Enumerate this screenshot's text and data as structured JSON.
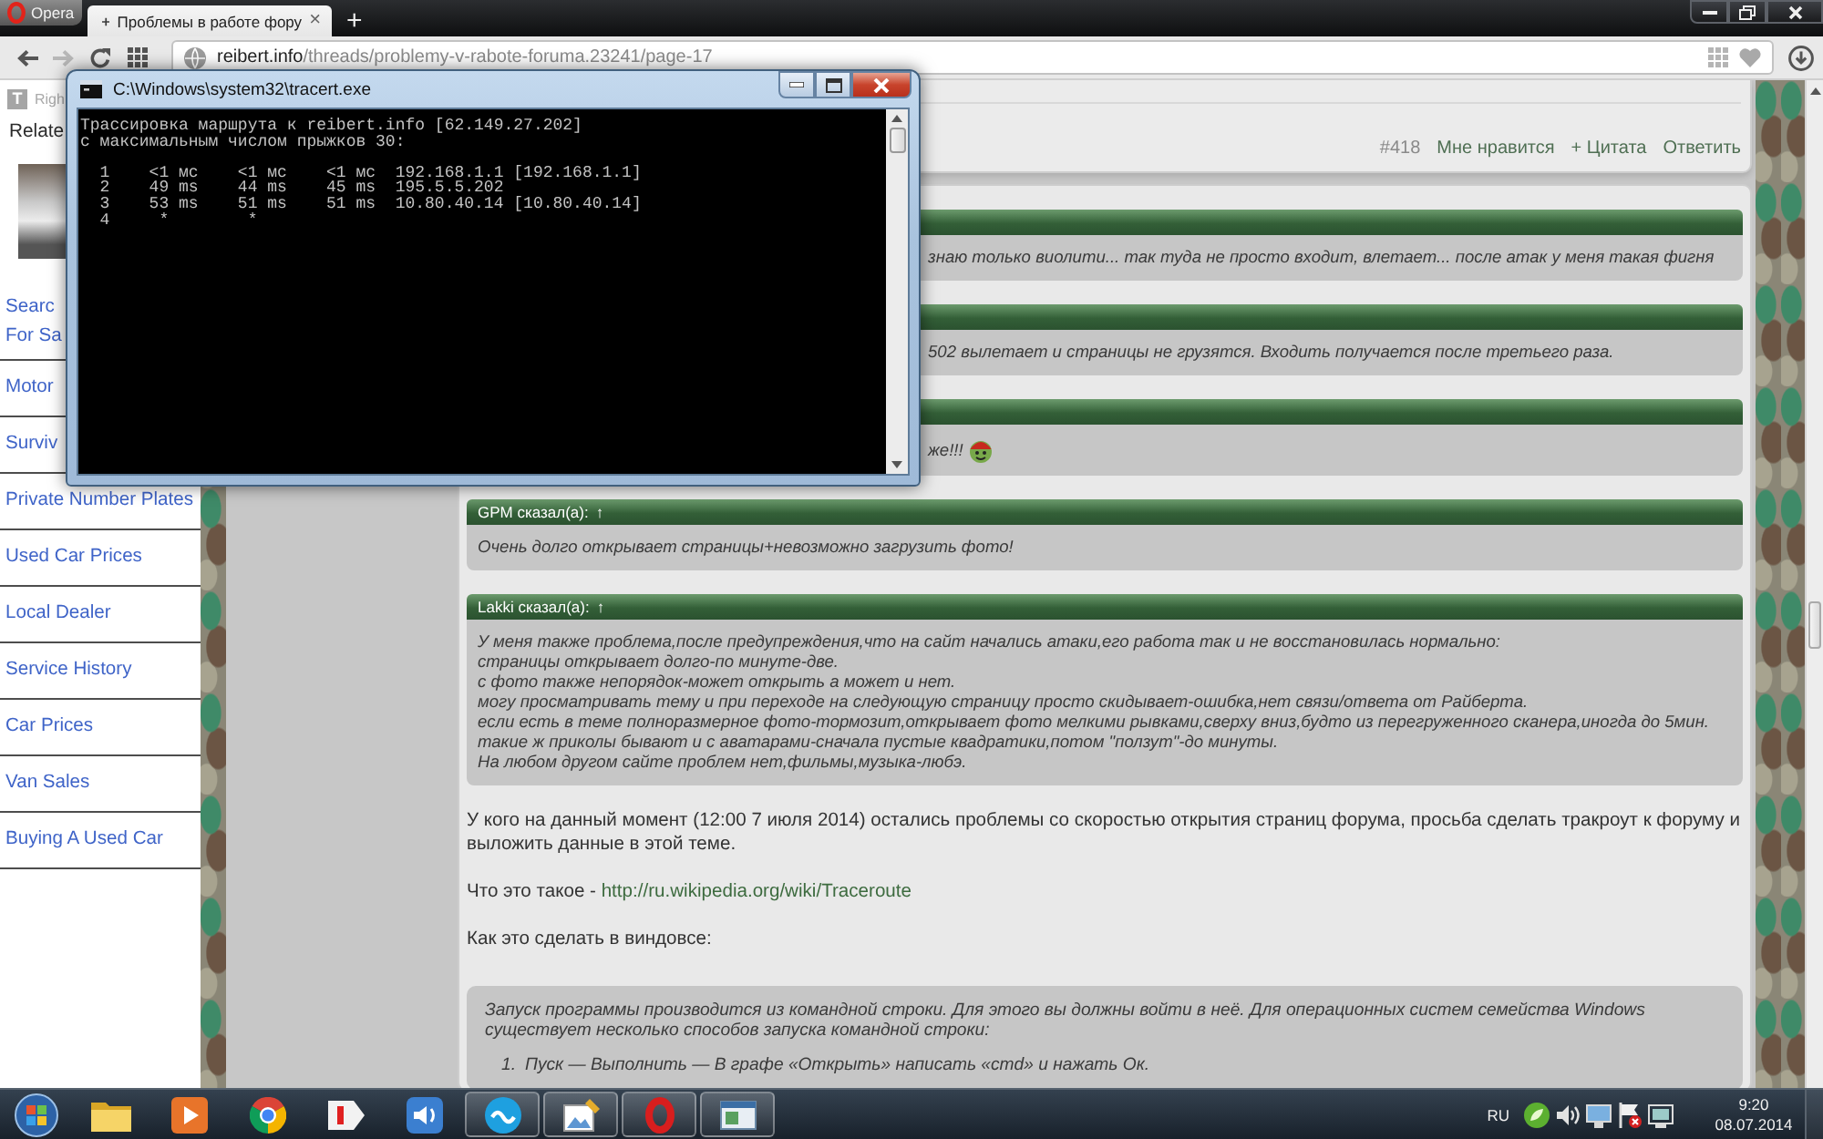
{
  "browser": {
    "menu_button": "Opera",
    "tabs": [
      {
        "title": "Проблемы в работе фору",
        "close": "×",
        "selected": true
      }
    ],
    "new_tab": "+",
    "back": {
      "disabled": false
    },
    "forward": {
      "disabled": true
    },
    "url_host": "reibert.info",
    "url_path": "/threads/problemy-v-rabote-foruma.23241/page-17"
  },
  "sidebar": {
    "ad_badge": "T",
    "ad_label": "Righ",
    "heading": "Relate",
    "links": [
      [
        "Searc",
        "For Sa"
      ],
      [
        "Motor"
      ],
      [
        "Surviv"
      ],
      [
        "Private Number Plates"
      ],
      [
        "Used Car Prices"
      ],
      [
        "Local Dealer"
      ],
      [
        "Service History"
      ],
      [
        "Car Prices"
      ],
      [
        "Van Sales"
      ],
      [
        "Buying A Used Car"
      ]
    ]
  },
  "previous_post": {
    "number": "#418",
    "actions": [
      "Мне нравится",
      "+ Цитата",
      "Ответить"
    ]
  },
  "post": {
    "blocks": [
      {
        "kind": "quote",
        "text": [
          "знаю только виолити... так туда не просто входит, влетает... после атак у меня такая фигня"
        ]
      },
      {
        "kind": "quote",
        "text": [
          "502 вылетает и страницы не грузятся. Входить получается после третьего раза."
        ]
      },
      {
        "kind": "quote",
        "text": [
          "же!!!"
        ],
        "smiley": true
      },
      {
        "kind": "quote",
        "author": "GPM сказал(а):",
        "jump": "↑",
        "text": [
          "Очень долго открывает страницы+невозможно загрузить фото!"
        ]
      },
      {
        "kind": "quote",
        "author": "Lakki сказал(а):",
        "jump": "↑",
        "text": [
          "У меня также проблема,после предупреждения,что на сайт начались атаки,его работа так и не восстановилась нормально:",
          "страницы открывает долго-по минуте-две.",
          "с фото также непорядок-может открыть а может и нет.",
          "могу просматривать тему и при переходе на следующую страницу просто скидывает-ошибка,нет связи/ответа от Райберта.",
          "если есть в теме полноразмерное фото-тормозит,открывает фото мелкими рывками,сверху вниз,будто из перегруженного сканера,иногда до 5мин.",
          "такие ж приколы бывают и с аватарами-сначала пустые квадратики,потом \"ползут\"-до минуты.",
          "На любом другом сайте проблем нет,фильмы,музыка-любэ."
        ]
      },
      {
        "kind": "paragraph",
        "text": "У кого на данный момент (12:00 7 июля 2014) остались проблемы со скоростью открытия страниц форума, просьба сделать тракроут к форуму и выложить данные в этой теме."
      },
      {
        "kind": "link_paragraph",
        "text": "Что это такое - ",
        "link": "http://ru.wikipedia.org/wiki/Traceroute"
      },
      {
        "kind": "paragraph",
        "text": "Как это сделать в виндовсе:"
      },
      {
        "kind": "box",
        "text": "Запуск программы производится из командной строки. Для этого вы должны войти в неё. Для операционных систем семейства Windows существует несколько способов запуска командной строки:",
        "items": [
          {
            "number": "1.",
            "text": "Пуск — Выполнить — В графе «Открыть» написать «cmd» и нажать Ок."
          }
        ]
      }
    ]
  },
  "console_window": {
    "title": "C:\\Windows\\system32\\tracert.exe",
    "header_lines": [
      "Трассировка маршрута к reibert.info [62.149.27.202]",
      "с максимальным числом прыжков 30:"
    ],
    "hop_lines": [
      "  1    <1 мс    <1 мс    <1 мс  192.168.1.1 [192.168.1.1]",
      "  2    49 ms    44 ms    45 ms  195.5.5.202",
      "  3    53 ms    51 ms    51 ms  10.80.40.14 [10.80.40.14]",
      "  4     *        *"
    ]
  },
  "taskbar": {
    "apps": [
      {
        "running": false
      },
      {
        "running": false
      },
      {
        "running": false
      },
      {
        "running": false
      },
      {
        "running": false
      },
      {
        "running": true
      },
      {
        "running": true
      },
      {
        "running": true
      },
      {
        "running": true
      }
    ],
    "language": "RU",
    "time": "9:20",
    "date": "08.07.2014"
  }
}
